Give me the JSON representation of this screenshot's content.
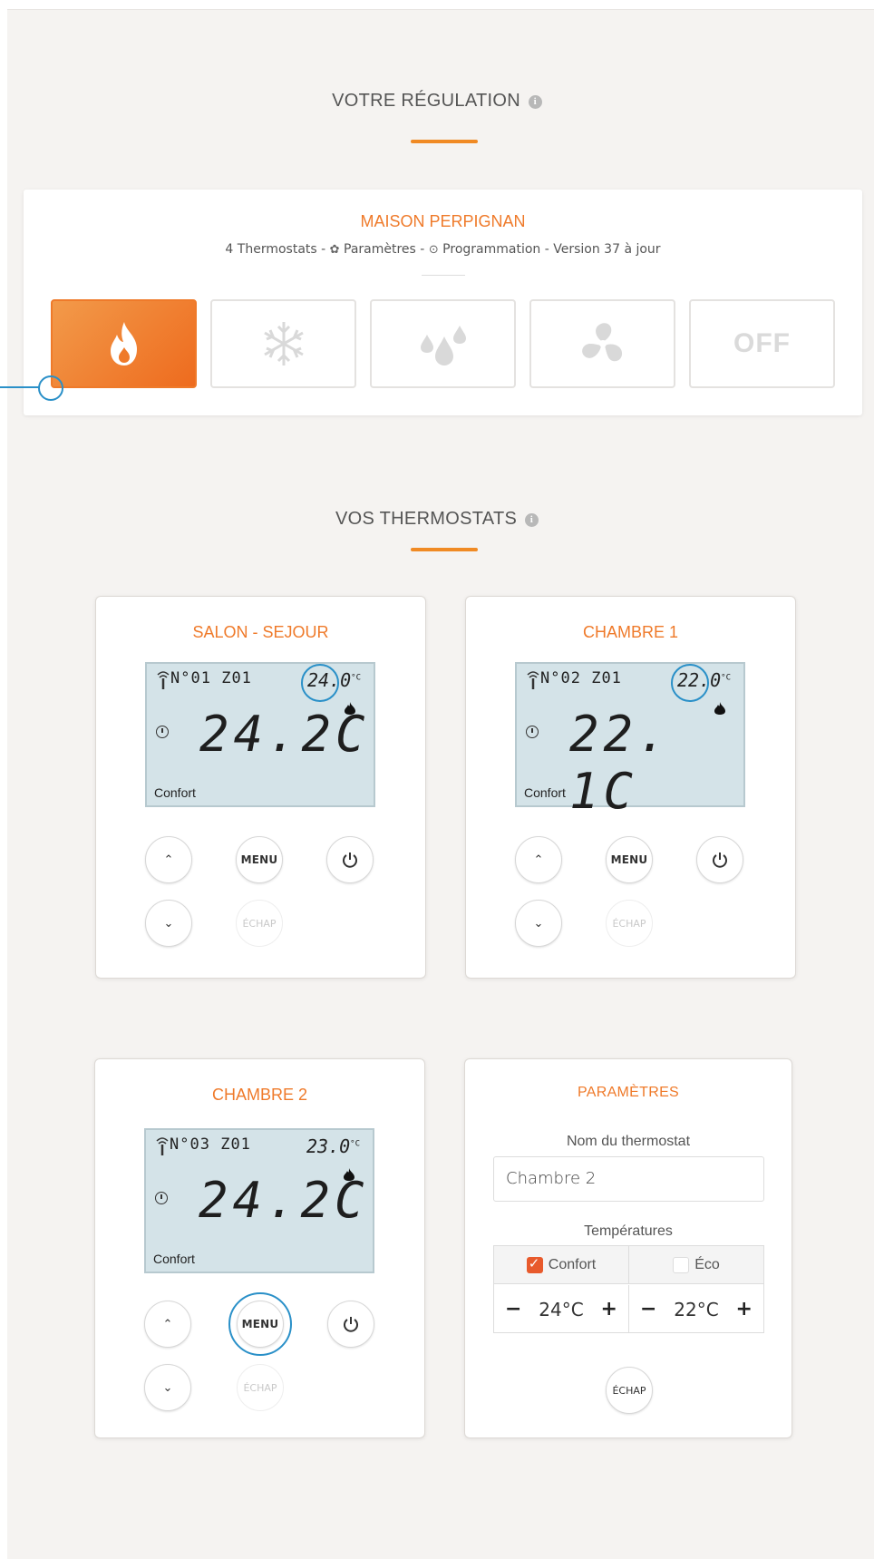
{
  "regulation": {
    "title": "VOTRE RÉGULATION",
    "info_icon": "info-icon",
    "house_name": "MAISON PERPIGNAN",
    "meta_count": "4 Thermostats",
    "meta_settings": "Paramètres",
    "meta_programming": "Programmation",
    "meta_version": "Version 37 à jour",
    "sep": "-",
    "modes": [
      {
        "name": "heat",
        "icon": "flame-icon",
        "active": true
      },
      {
        "name": "cool",
        "icon": "snowflake-icon",
        "active": false
      },
      {
        "name": "dehumidify",
        "icon": "drops-icon",
        "active": false
      },
      {
        "name": "fan",
        "icon": "fan-icon",
        "active": false
      },
      {
        "name": "off",
        "label": "OFF",
        "active": false
      }
    ]
  },
  "thermostats_section": {
    "title": "VOS THERMOSTATS"
  },
  "thermostats": [
    {
      "title": "SALON - SEJOUR",
      "number": "N°01",
      "zone": "Z01",
      "setpoint": "24.0",
      "temp": "24.2C",
      "mode": "Confort"
    },
    {
      "title": "CHAMBRE 1",
      "number": "N°02",
      "zone": "Z01",
      "setpoint": "22.0",
      "temp": "22. 1C",
      "mode": "Confort"
    },
    {
      "title": "CHAMBRE 2",
      "number": "N°03",
      "zone": "Z01",
      "setpoint": "23.0",
      "temp": "24.2C",
      "mode": "Confort"
    }
  ],
  "controls": {
    "menu": "MENU",
    "escape": "ÉCHAP",
    "unit": "°C"
  },
  "params": {
    "title": "PARAMÈTRES",
    "name_label": "Nom du thermostat",
    "name_value": "Chambre 2",
    "temps_label": "Températures",
    "confort_label": "Confort",
    "eco_label": "Éco",
    "confort_checked": true,
    "eco_checked": false,
    "confort_value": "24°C",
    "eco_value": "22°C",
    "minus": "−",
    "plus": "+",
    "escape": "ÉCHAP"
  },
  "colors": {
    "accent": "#ef7a2a",
    "highlight": "#2a90c8",
    "lcd": "#d4e3e8"
  }
}
